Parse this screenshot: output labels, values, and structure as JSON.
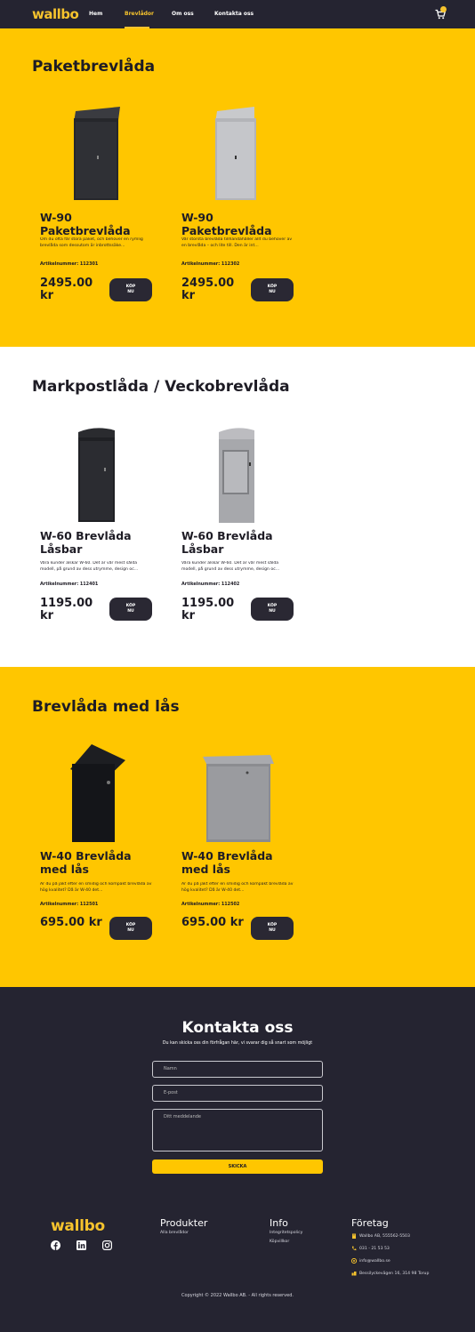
{
  "nav": {
    "logo": "wallbo",
    "links": [
      "Hem",
      "Brevlådor",
      "Om oss",
      "Kontakta oss"
    ],
    "active_index": 1,
    "icons": [
      "cart-icon"
    ]
  },
  "colors": {
    "brand_yellow": "#ffc600",
    "dark": "#252431",
    "button": "#2a2833"
  },
  "sections": [
    {
      "title": "Paketbrevlåda",
      "products": [
        {
          "name": "W-90 Paketbrevlåda",
          "desc": "Om du ofta får stora paket, och behöver en rymlig brevlåda som dessutom är inbrottssäke...",
          "article": "Artikelnummer: 112301",
          "price": "2495.00 kr",
          "button": "KÖP NU",
          "image": "black tall parcel box"
        },
        {
          "name": "W-90 Paketbrevlåda",
          "desc": "Vår största brevlåda tillhandahåller allt du behöver av en brevlåda – och lite till. Den är int...",
          "article": "Artikelnummer: 112302",
          "price": "2495.00 kr",
          "button": "KÖP NU",
          "image": "silver tall parcel box"
        }
      ]
    },
    {
      "title": "Markpostlåda / Veckobrevlåda",
      "products": [
        {
          "name": "W-60 Brevlåda Låsbar",
          "desc": "Våra kunder älskar W-60. Det är vår mest sålda modell, på grund av dess utrymme, design oc...",
          "article": "Artikelnummer: 112401",
          "price": "1195.00 kr",
          "button": "KÖP NU",
          "image": "black standing mailbox"
        },
        {
          "name": "W-60 Brevlåda Låsbar",
          "desc": "Våra kunder älskar W-60. Det är vår mest sålda modell, på grund av dess utrymme, design oc...",
          "article": "Artikelnummer: 112402",
          "price": "1195.00 kr",
          "button": "KÖP NU",
          "image": "silver standing mailbox"
        }
      ]
    },
    {
      "title": "Brevlåda med lås",
      "products": [
        {
          "name": "W-40 Brevlåda med lås",
          "desc": "Är du på jakt efter en smidig och kompakt brevlåda av hög kvalitet? Då är W-40 det...",
          "article": "Artikelnummer: 112501",
          "price": "695.00 kr",
          "button": "KÖP NU",
          "image": "black wall mailbox"
        },
        {
          "name": "W-40 Brevlåda med lås",
          "desc": "Är du på jakt efter en smidig och kompakt brevlåda av hög kvalitet? Då är W-40 det...",
          "article": "Artikelnummer: 112502",
          "price": "695.00 kr",
          "button": "KÖP NU",
          "image": "silver wall mailbox"
        }
      ]
    }
  ],
  "contact": {
    "title": "Kontakta oss",
    "subtitle": "Du kan skicka oss din förfrågan här, vi svarar dig så snart som möjligt",
    "name_placeholder": "Namn",
    "email_placeholder": "E-post",
    "message_placeholder": "Ditt meddelande",
    "submit": "SKICKA"
  },
  "footer": {
    "logo": "wallbo",
    "social_icons": [
      "facebook-icon",
      "linkedin-icon",
      "instagram-icon"
    ],
    "produkter": {
      "title": "Produkter",
      "links": [
        "Alla brevlådor"
      ]
    },
    "info": {
      "title": "Info",
      "links": [
        "Integritetspolicy",
        "Köpvillkor"
      ]
    },
    "foretag": {
      "title": "Företag",
      "items": [
        "Wallbo AB, 555562-5503",
        "031 - 21 53 53",
        "info@wallbo.se",
        "Bessilyckevägen 16, 314 98 Torup"
      ]
    },
    "copyright": "Copyright © 2022 Wallbo AB. - All rights reserved."
  }
}
